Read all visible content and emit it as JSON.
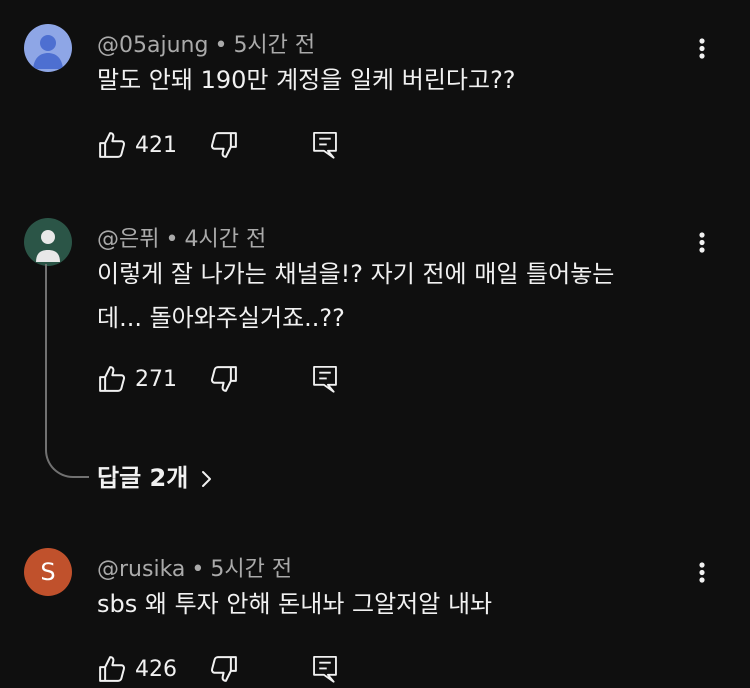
{
  "comments": [
    {
      "author": "@05ajung",
      "time": "5시간 전",
      "text": "말도 안돼 190만 계정을 일케 버린다고??",
      "likes": "421",
      "avatar_color": "#8ea6e6",
      "avatar_type": "person-default"
    },
    {
      "author": "@은퓌",
      "time": "4시간 전",
      "text": "이렇게 잘 나가는 채널을!? 자기 전에 매일 틀어놓는데... 돌아와주실거죠..??",
      "text_line1": "이렇게 잘 나가는 채널을!? 자기 전에 매일 틀어놓는",
      "text_line2": "데... 돌아와주실거죠..??",
      "likes": "271",
      "avatar_color": "#2b5547",
      "avatar_type": "person-default"
    },
    {
      "author": "@rusika",
      "time": "5시간 전",
      "text": "sbs 왜 투자 안해 돈내놔 그알저알 내놔",
      "likes": "426",
      "avatar_color": "#c0512c",
      "avatar_letter": "S"
    }
  ],
  "replies_label": "답글 2개",
  "icons": {
    "like": "thumbs-up-icon",
    "dislike": "thumbs-down-icon",
    "reply": "reply-icon",
    "more": "more-vert-icon",
    "chevron": "chevron-right-icon"
  }
}
